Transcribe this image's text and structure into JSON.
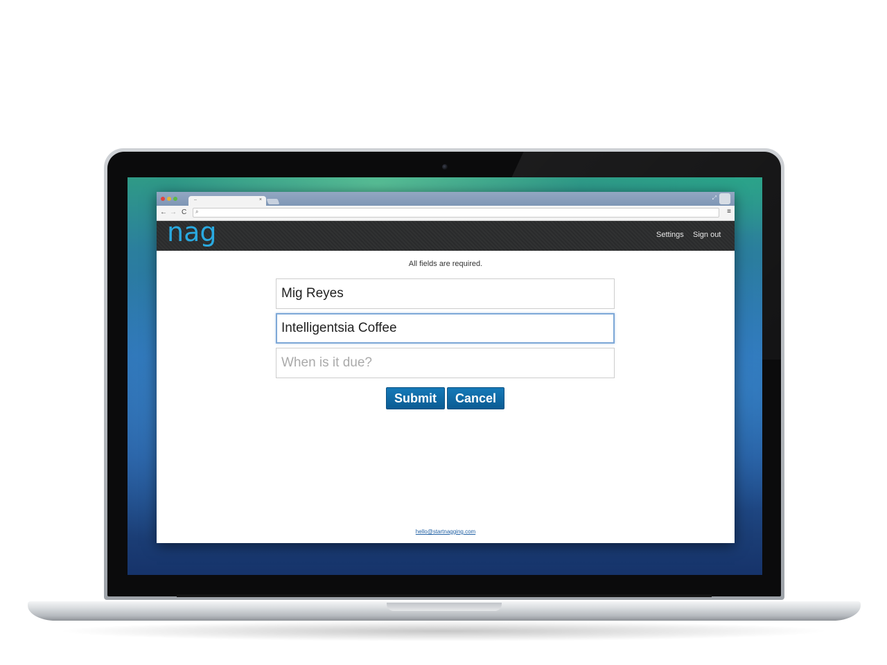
{
  "browser": {
    "tab_title": "–",
    "tab_close": "×",
    "nav_back": "←",
    "nav_forward": "→",
    "nav_reload": "C",
    "menu": "≡",
    "resize": "⤢",
    "search_glyph": "⌕"
  },
  "site": {
    "logo": "nag",
    "nav": {
      "settings": "Settings",
      "sign_out": "Sign out"
    },
    "form": {
      "note": "All fields are required.",
      "name_value": "Mig Reyes",
      "task_value": "Intelligentsia Coffee",
      "due_placeholder": "When is it due?",
      "submit_label": "Submit",
      "cancel_label": "Cancel"
    },
    "footer_email": "hello@startnagging.com"
  },
  "colors": {
    "accent": "#29a9e0",
    "button": "#0b5c93",
    "header": "#2a2b2c",
    "focus_border": "#7ea8d7"
  }
}
